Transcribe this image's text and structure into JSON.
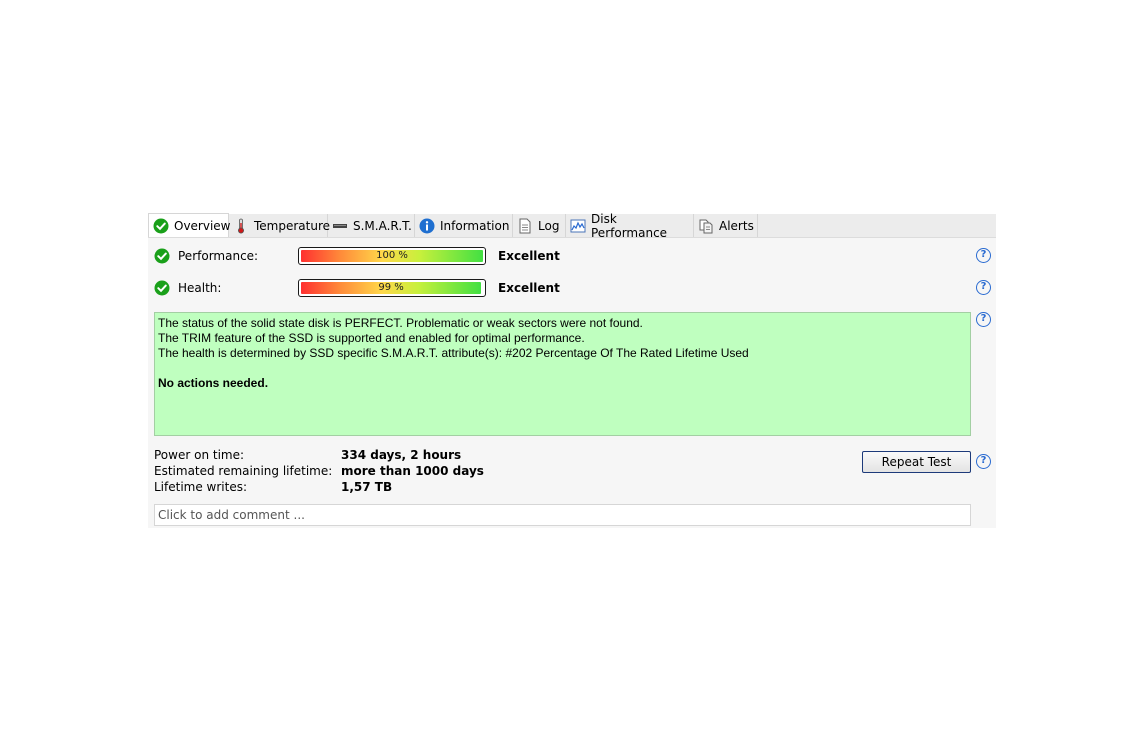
{
  "tabs": [
    {
      "label": "Overview",
      "icon": "check-circle-icon"
    },
    {
      "label": "Temperature",
      "icon": "thermometer-icon"
    },
    {
      "label": "S.M.A.R.T.",
      "icon": "disk-icon"
    },
    {
      "label": "Information",
      "icon": "info-icon"
    },
    {
      "label": "Log",
      "icon": "document-icon"
    },
    {
      "label": "Disk Performance",
      "icon": "chart-icon"
    },
    {
      "label": "Alerts",
      "icon": "alerts-icon"
    }
  ],
  "performance": {
    "label": "Performance:",
    "percent_text": "100 %",
    "value": 100,
    "rating": "Excellent"
  },
  "health": {
    "label": "Health:",
    "percent_text": "99 %",
    "value": 99,
    "rating": "Excellent"
  },
  "status": {
    "lines": [
      "The status of the solid state disk is PERFECT. Problematic or weak sectors were not found.",
      "The TRIM feature of the SSD is supported and enabled for optimal performance.",
      "The health is determined by SSD specific S.M.A.R.T. attribute(s):  #202 Percentage Of The Rated Lifetime Used"
    ],
    "action": "No actions needed.",
    "background": "#bfffbf"
  },
  "info": {
    "power_on_label": "Power on time:",
    "power_on_value": "334 days, 2 hours",
    "remaining_label": "Estimated remaining lifetime:",
    "remaining_value": "more than 1000 days",
    "writes_label": "Lifetime writes:",
    "writes_value": "1,57 TB"
  },
  "repeat_button": "Repeat Test",
  "help_symbol": "?",
  "comment": {
    "placeholder": "Click to add comment ...",
    "value": ""
  },
  "colors": {
    "accent": "#2a6bd1",
    "ok_green": "#1aa01a",
    "status_green": "#bfffbf"
  }
}
